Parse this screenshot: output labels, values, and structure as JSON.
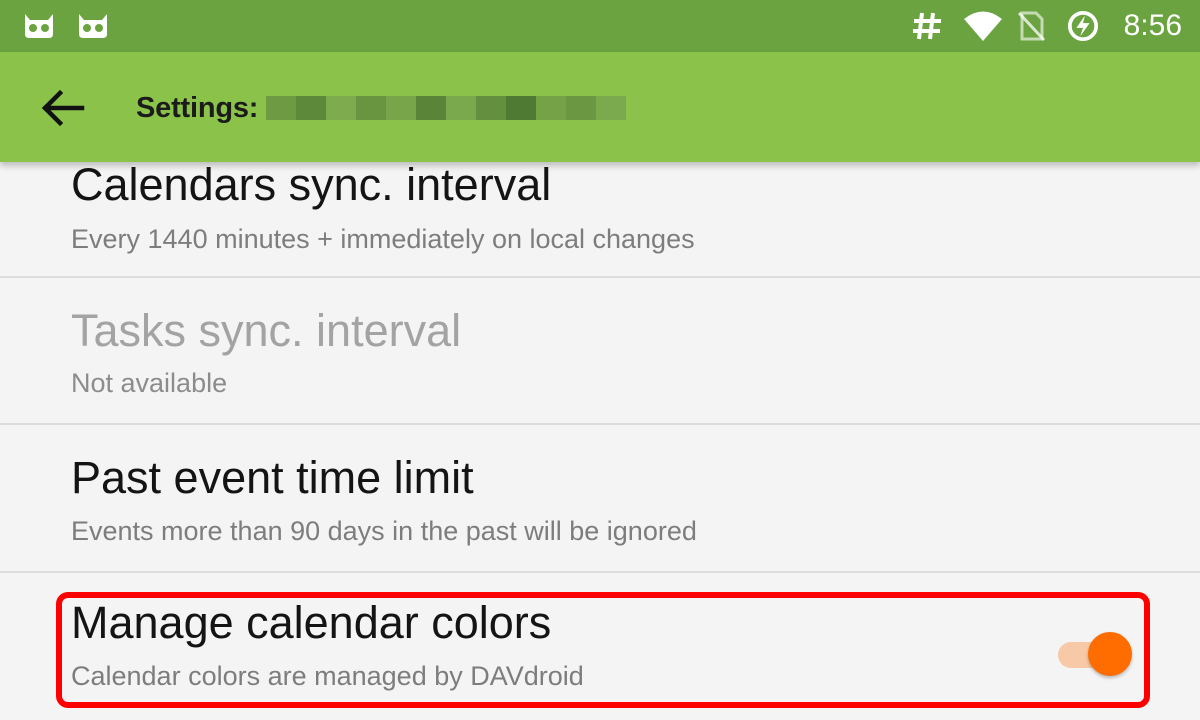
{
  "status_bar": {
    "time": "8:56",
    "left_icons": [
      "android-debug-icon",
      "android-debug-icon"
    ],
    "right_icons": [
      "hash-icon",
      "wifi-icon",
      "no-sim-icon",
      "battery-charging-icon"
    ],
    "background": "#6aa33f"
  },
  "app_bar": {
    "back_icon": "arrow-back-icon",
    "title": "Settings:",
    "title_redacted": true,
    "background": "#8bc34a"
  },
  "preferences": [
    {
      "title": "Calendars sync. interval",
      "summary": "Every 1440 minutes + immediately on local changes",
      "enabled": true
    },
    {
      "title": "Tasks sync. interval",
      "summary": "Not available",
      "enabled": false
    },
    {
      "title": "Past event time limit",
      "summary": "Events more than 90 days in the past will be ignored",
      "enabled": true
    },
    {
      "title": "Manage calendar colors",
      "summary": "Calendar colors are managed by DAVdroid",
      "enabled": true,
      "switch_on": true,
      "highlighted": true
    }
  ],
  "colors": {
    "accent": "#ff6d00",
    "accent_track": "#f7c9a6",
    "highlight": "#ff0000"
  }
}
